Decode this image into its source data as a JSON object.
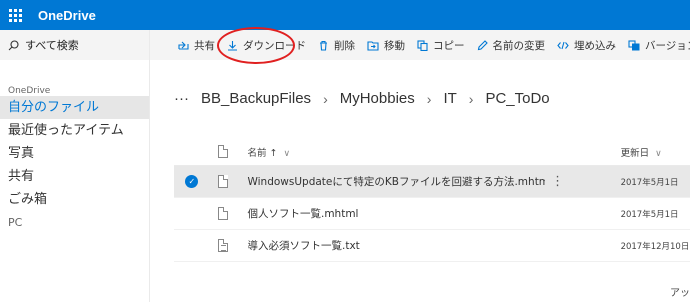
{
  "app": {
    "title": "OneDrive"
  },
  "nav": {
    "search_label": "すべて検索",
    "owner": "OneDrive",
    "items": [
      {
        "label": "自分のファイル",
        "active": true
      },
      {
        "label": "最近使ったアイテム"
      },
      {
        "label": "写真"
      },
      {
        "label": "共有"
      },
      {
        "label": "ごみ箱"
      },
      {
        "label": "PC"
      }
    ]
  },
  "commands": [
    {
      "label": "共有",
      "icon": "share-icon"
    },
    {
      "label": "ダウンロード",
      "icon": "download-icon"
    },
    {
      "label": "削除",
      "icon": "delete-icon"
    },
    {
      "label": "移動",
      "icon": "move-icon"
    },
    {
      "label": "コピー",
      "icon": "copy-icon"
    },
    {
      "label": "名前の変更",
      "icon": "rename-icon"
    },
    {
      "label": "埋め込み",
      "icon": "embed-icon"
    },
    {
      "label": "バージョン履歴",
      "icon": "version-history-icon"
    }
  ],
  "breadcrumb": {
    "overflow": "···",
    "items": [
      "BB_BackupFiles",
      "MyHobbies",
      "IT",
      "PC_ToDo"
    ]
  },
  "list": {
    "headers": {
      "name": "名前 ↑",
      "modified": "更新日"
    },
    "rows": [
      {
        "name": "WindowsUpdateにて特定のKBファイルを回避する方法.mhtml",
        "modified": "2017年5月1日",
        "selected": true,
        "more": "⋮"
      },
      {
        "name": "個人ソフト一覧.mhtml",
        "modified": "2017年5月1日"
      },
      {
        "name": "導入必須ソフト一覧.txt",
        "modified": "2017年12月10日"
      }
    ]
  },
  "footer": {
    "text": "アッ"
  },
  "colors": {
    "accent": "#0078d4",
    "annotation": "#e02020"
  }
}
